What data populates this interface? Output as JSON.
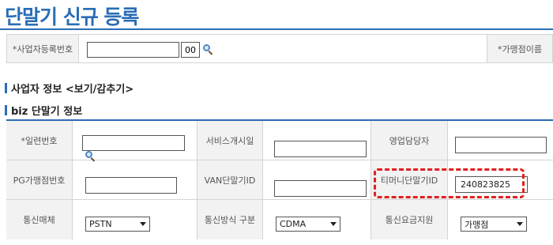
{
  "page": {
    "title": "단말기 신규 등록"
  },
  "search": {
    "biz_no_label": "*사업자등록번호",
    "biz_no_value": "",
    "biz_code_value": "00",
    "merchant_name_label": "*가맹점이름"
  },
  "sections": {
    "biz_info_title": "사업자 정보 <보기/감추기>",
    "terminal_info_title": "biz 단말기 정보"
  },
  "terminal": {
    "serial_label": "*일련번호",
    "serial_value": "",
    "service_start_label": "서비스개시일",
    "service_start_value": "",
    "sales_rep_label": "영업담당자",
    "sales_rep_value": "",
    "pg_merchant_no_label": "PG가맹점번호",
    "pg_merchant_no_value": "",
    "van_terminal_id_label": "VAN단말기ID",
    "van_terminal_id_value": "",
    "timoney_terminal_id_label": "티머니단말기ID",
    "timoney_terminal_id_value": "240823825",
    "comm_media_label": "통신매체",
    "comm_media_value": "PSTN",
    "comm_method_label": "통신방식 구분",
    "comm_method_value": "CDMA",
    "comm_fee_support_label": "통신요금지원",
    "comm_fee_support_value": "가맹점"
  },
  "colors": {
    "accent": "#2a6db5",
    "highlight": "#e0201e",
    "label_bg": "#f2f2f2"
  },
  "icons": {
    "search": "magnifier-icon"
  }
}
